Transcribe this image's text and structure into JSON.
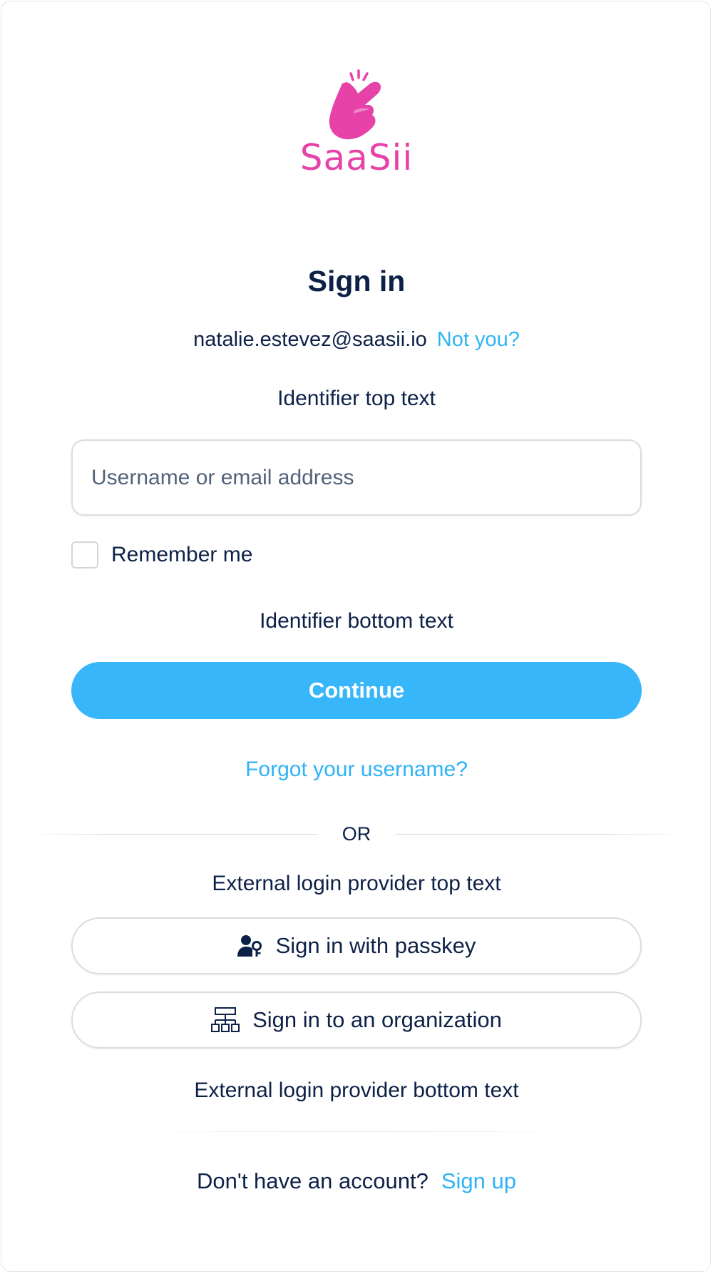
{
  "brand": {
    "name": "SaaSii",
    "color": "#e642a7"
  },
  "signin": {
    "title": "Sign in",
    "email": "natalie.estevez@saasii.io",
    "not_you": "Not you?",
    "identifier_top_text": "Identifier top text",
    "username_placeholder": "Username or email address",
    "username_value": "",
    "remember_label": "Remember me",
    "remember_checked": false,
    "identifier_bottom_text": "Identifier bottom text",
    "continue_label": "Continue",
    "forgot_username": "Forgot your username?"
  },
  "separator": {
    "label": "OR"
  },
  "external": {
    "top_text": "External login provider top text",
    "passkey_label": "Sign in with passkey",
    "passkey_icon": "user-key-icon",
    "organization_label": "Sign in to an organization",
    "organization_icon": "org-chart-icon",
    "bottom_text": "External login provider bottom text"
  },
  "footer": {
    "prompt": "Don't have an account?",
    "signup_label": "Sign up"
  },
  "colors": {
    "primary": "#38b6fa",
    "link": "#2fb3f5",
    "text": "#0d2147"
  }
}
